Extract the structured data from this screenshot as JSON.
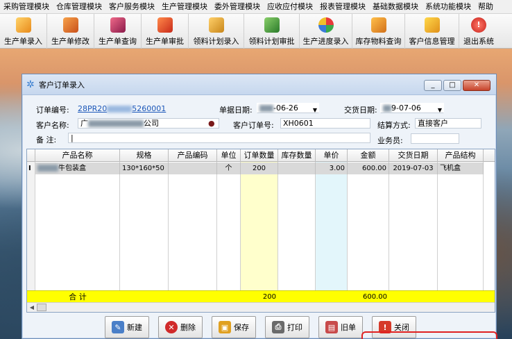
{
  "menu": [
    "采购管理模块",
    "仓库管理模块",
    "客户服务模块",
    "生产管理模块",
    "委外管理模块",
    "应收应付模块",
    "报表管理模块",
    "基础数据模块",
    "系统功能模块",
    "帮助"
  ],
  "toolbar": [
    {
      "label": "生产单录入",
      "icon": "box-add-icon",
      "color": "#f0a030"
    },
    {
      "label": "生产单修改",
      "icon": "box-edit-icon",
      "color": "#e0702a"
    },
    {
      "label": "生产单查询",
      "icon": "search-box-icon",
      "color": "#c8306a"
    },
    {
      "label": "生产单审批",
      "icon": "approve-icon",
      "color": "#e85a2a"
    },
    {
      "label": "领料计划录入",
      "icon": "material-plan-icon",
      "color": "#e2a22c"
    },
    {
      "label": "领料计划审批",
      "icon": "material-approve-icon",
      "color": "#4aa04a"
    },
    {
      "label": "生产进度录入",
      "icon": "progress-icon",
      "color": "#3a86c8"
    },
    {
      "label": "库存物料查询",
      "icon": "stock-query-icon",
      "color": "#e69a26"
    },
    {
      "label": "客户信息管理",
      "icon": "customer-icon",
      "color": "#f0b22c"
    },
    {
      "label": "退出系统",
      "icon": "exit-icon",
      "color": "#d2322a"
    }
  ],
  "window": {
    "title": "客户订单录入",
    "minimize": "_",
    "restore": "□",
    "close": "✕"
  },
  "form": {
    "order_no_label": "订单编号:",
    "order_no_prefix": "28PR20",
    "order_no_suffix": "5260001",
    "bill_date_label": "单据日期:",
    "bill_date": "-06-26",
    "delivery_date_label": "交货日期:",
    "delivery_date": "9-07-06",
    "customer_label": "客户名称:",
    "customer_value": "公司",
    "customer_prefix": "广",
    "cust_order_label": "客户订单号:",
    "cust_order_value": "XH0601",
    "settle_label": "结算方式:",
    "settle_value": "直接客户",
    "remark_label": "备  注:",
    "salesman_label": "业务员:"
  },
  "grid": {
    "headers": [
      "产品名称",
      "规格",
      "产品编码",
      "单位",
      "订单数量",
      "库存数量",
      "单价",
      "金额",
      "交货日期",
      "产品结构"
    ],
    "rows": [
      {
        "marker": "I",
        "name": "牛包装盒",
        "spec": "130*160*50",
        "code": "",
        "unit": "个",
        "qty": "200",
        "stock": "",
        "price": "3.00",
        "amount": "600.00",
        "date": "2019-07-03",
        "structure": "飞机盒"
      }
    ],
    "total": {
      "label": "合 计",
      "qty": "200",
      "amount": "600.00"
    }
  },
  "buttons": [
    {
      "label": "新建",
      "icon": "new-icon",
      "color": "#4a7fc8",
      "glyph": "✎"
    },
    {
      "label": "删除",
      "icon": "delete-icon",
      "color": "#d02a2a",
      "glyph": "✕"
    },
    {
      "label": "保存",
      "icon": "save-icon",
      "color": "#e0a020",
      "glyph": "▣"
    },
    {
      "label": "打印",
      "icon": "print-icon",
      "color": "#6a6a6a",
      "glyph": "⎙"
    },
    {
      "label": "旧单",
      "icon": "old-bill-icon",
      "color": "#c84a4a",
      "glyph": "▤"
    },
    {
      "label": "关闭",
      "icon": "close-icon",
      "color": "#d63a2a",
      "glyph": "!"
    }
  ]
}
